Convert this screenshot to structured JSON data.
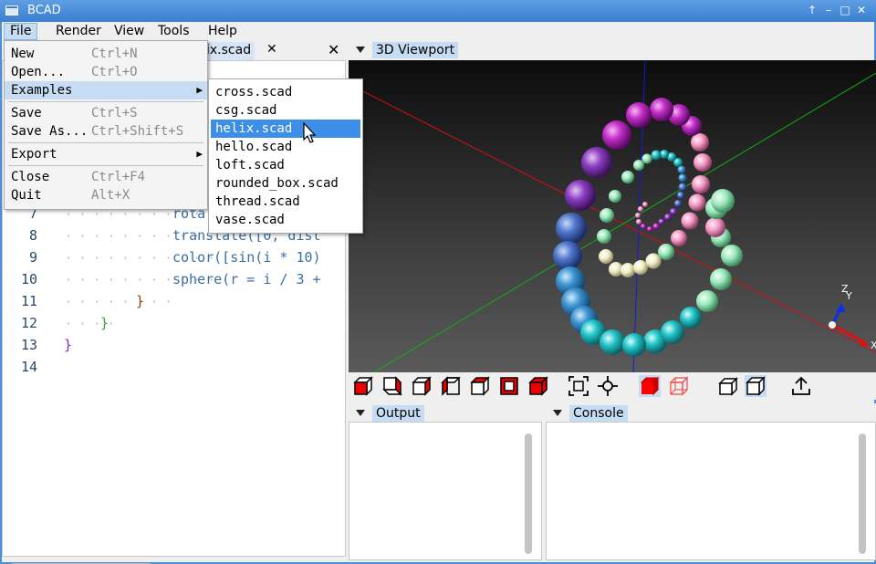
{
  "window": {
    "title": "BCAD"
  },
  "menubar": {
    "items": [
      "File",
      "Render",
      "View",
      "Tools",
      "Help"
    ]
  },
  "file_menu": {
    "items": [
      {
        "label": "New",
        "shortcut": "Ctrl+N"
      },
      {
        "label": "Open...",
        "shortcut": "Ctrl+O"
      },
      {
        "label": "Examples",
        "shortcut": ""
      },
      {
        "label": "Save",
        "shortcut": "Ctrl+S"
      },
      {
        "label": "Save As...",
        "shortcut": "Ctrl+Shift+S"
      },
      {
        "label": "Export",
        "shortcut": ""
      },
      {
        "label": "Close",
        "shortcut": "Ctrl+F4"
      },
      {
        "label": "Quit",
        "shortcut": "Alt+X"
      }
    ]
  },
  "examples_menu": {
    "items": [
      "cross.scad",
      "csg.scad",
      "helix.scad",
      "hello.scad",
      "loft.scad",
      "rounded_box.scad",
      "thread.scad",
      "vase.scad"
    ],
    "selected": "helix.scad"
  },
  "editor": {
    "tab_label": "ix.scad",
    "tab_close": "✕",
    "panel_close": "✕",
    "visible_lines": [
      {
        "n": "7",
        "text": "rota"
      },
      {
        "n": "8",
        "text": "translate([0, dist"
      },
      {
        "n": "9",
        "text": "color([sin(i * 10)"
      },
      {
        "n": "10",
        "text": "sphere(r = i / 3 +"
      },
      {
        "n": "11",
        "text": "}"
      },
      {
        "n": "12",
        "text": "}"
      },
      {
        "n": "13",
        "text": "}"
      },
      {
        "n": "14",
        "text": ""
      }
    ]
  },
  "viewport": {
    "title": "3D Viewport",
    "axis_labels": {
      "z": "Z",
      "y": "Y",
      "x": "X"
    }
  },
  "panels": {
    "output": "Output",
    "console": "Console"
  },
  "icons": {
    "panel_toggle": "triangle-down-icon",
    "submenu": "arrow-right-icon",
    "export": "upload-icon"
  },
  "colors": {
    "accent": "#3d8ee6",
    "title_bar": "#4a8fdc",
    "toggle_on": "#ff0000"
  }
}
